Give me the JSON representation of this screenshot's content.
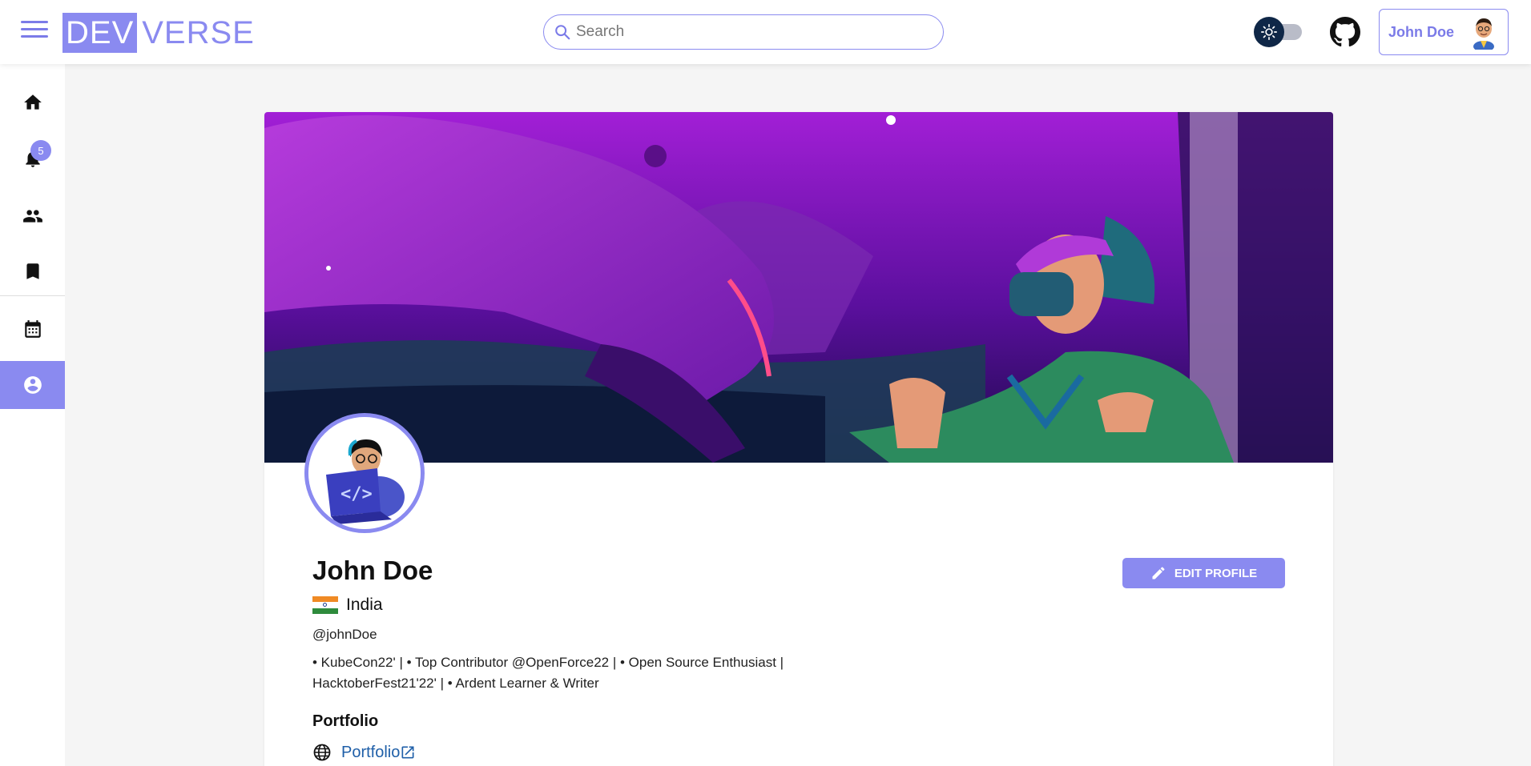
{
  "header": {
    "logo_dev": "DEV",
    "logo_verse": "VERSE",
    "search_placeholder": "Search",
    "user_name": "John Doe"
  },
  "sidebar": {
    "items": [
      {
        "name": "home",
        "icon": "home-icon"
      },
      {
        "name": "notifications",
        "icon": "bell-icon",
        "badge": "5"
      },
      {
        "name": "people",
        "icon": "people-icon"
      },
      {
        "name": "bookmarks",
        "icon": "bookmark-icon"
      },
      {
        "name": "events",
        "icon": "calendar-icon"
      },
      {
        "name": "profile",
        "icon": "account-circle-icon",
        "active": true
      }
    ]
  },
  "profile": {
    "name": "John Doe",
    "country": "India",
    "handle": "@johnDoe",
    "bio": "• KubeCon22' | • Top Contributor @OpenForce22 | • Open Source Enthusiast | HacktoberFest21'22' | • Ardent Learner & Writer",
    "edit_label": "EDIT PROFILE",
    "portfolio_heading": "Portfolio",
    "portfolio_link": "Portfolio"
  },
  "colors": {
    "accent": "#8a8af0",
    "link": "#1f5fa8",
    "theme_knob": "#0f2747"
  }
}
